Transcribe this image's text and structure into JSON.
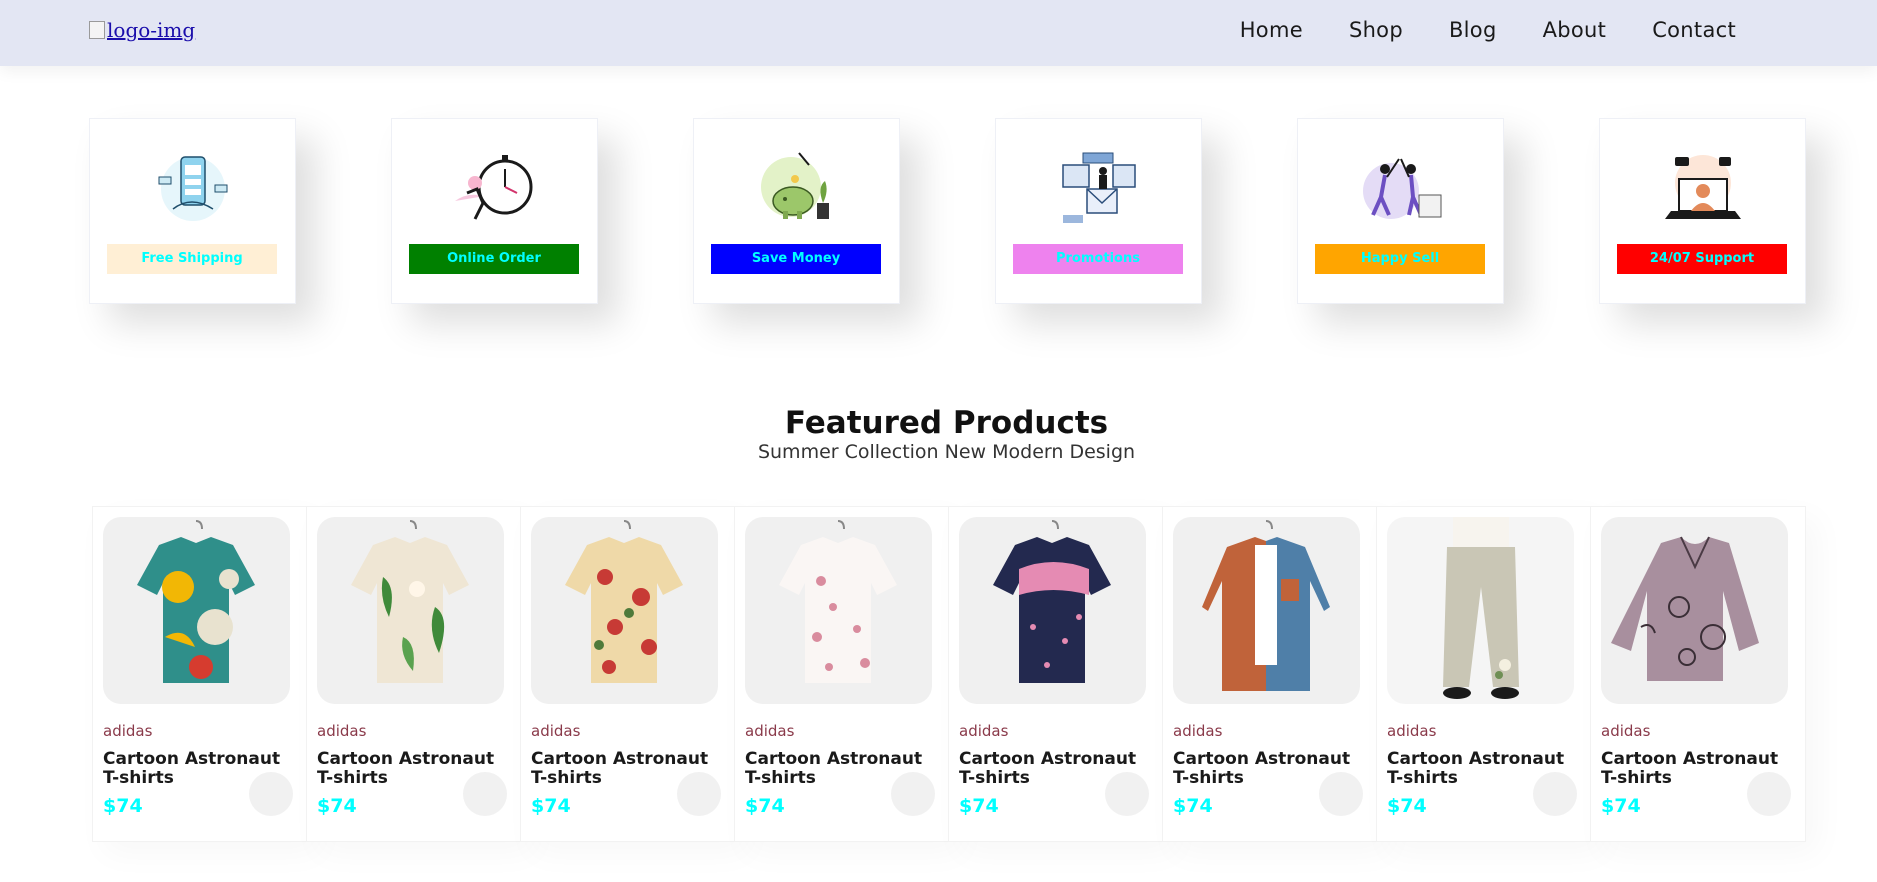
{
  "header": {
    "logo_alt": "logo-img",
    "nav": [
      "Home",
      "Shop",
      "Blog",
      "About",
      "Contact"
    ]
  },
  "features": [
    {
      "label": "Free Shipping",
      "bg": "#ffefd5",
      "color": "#00ffff",
      "icon": "phone-payment-illustration"
    },
    {
      "label": "Online Order",
      "bg": "#008000",
      "color": "#00ffff",
      "icon": "stopwatch-runner-illustration"
    },
    {
      "label": "Save Money",
      "bg": "#0000ff",
      "color": "#00ffff",
      "icon": "piggy-bank-illustration"
    },
    {
      "label": "Promotions",
      "bg": "#ee82ee",
      "color": "#00ffff",
      "icon": "mail-promo-illustration"
    },
    {
      "label": "Happy Sell",
      "bg": "#ffa500",
      "color": "#00ffff",
      "icon": "high-five-illustration"
    },
    {
      "label": "24/07 Support",
      "bg": "#ff0000",
      "color": "#00ffff",
      "icon": "laptop-support-illustration"
    }
  ],
  "section": {
    "title": "Featured Products",
    "subtitle": "Summer Collection New Modern Design"
  },
  "products": [
    {
      "brand": "adidas",
      "name": "Cartoon Astronaut T-shirts",
      "price": "$74",
      "image": "colorful-abstract-shirt"
    },
    {
      "brand": "adidas",
      "name": "Cartoon Astronaut T-shirts",
      "price": "$74",
      "image": "tropical-leaf-shirt"
    },
    {
      "brand": "adidas",
      "name": "Cartoon Astronaut T-shirts",
      "price": "$74",
      "image": "red-floral-cream-shirt"
    },
    {
      "brand": "adidas",
      "name": "Cartoon Astronaut T-shirts",
      "price": "$74",
      "image": "white-pink-blossom-shirt"
    },
    {
      "brand": "adidas",
      "name": "Cartoon Astronaut T-shirts",
      "price": "$74",
      "image": "navy-pink-floral-shirt"
    },
    {
      "brand": "adidas",
      "name": "Cartoon Astronaut T-shirts",
      "price": "$74",
      "image": "rust-denim-jacket"
    },
    {
      "brand": "adidas",
      "name": "Cartoon Astronaut T-shirts",
      "price": "$74",
      "image": "linen-trousers"
    },
    {
      "brand": "adidas",
      "name": "Cartoon Astronaut T-shirts",
      "price": "$74",
      "image": "mauve-paisley-blouse"
    }
  ]
}
